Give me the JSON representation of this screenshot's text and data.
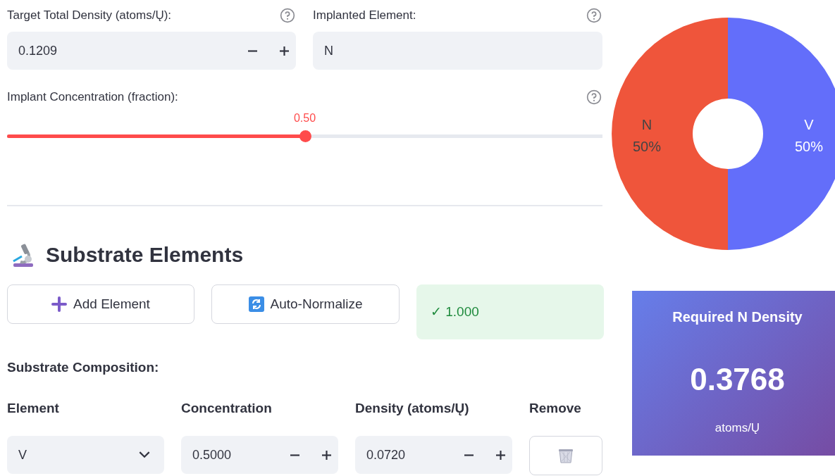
{
  "target_density": {
    "label": "Target Total Density (atoms/Ų):",
    "value": "0.1209"
  },
  "implanted_element": {
    "label": "Implanted Element:",
    "value": "N"
  },
  "implant_concentration": {
    "label": "Implant Concentration (fraction):",
    "reading": "0.50",
    "level": 0.5
  },
  "composition_chart": {
    "chart_data": {
      "type": "donut",
      "categories": [
        "N",
        "V"
      ],
      "values": [
        0.5,
        0.5
      ],
      "colors": [
        "#ef553b",
        "#636efa"
      ],
      "value_labels": [
        "50%",
        "50%"
      ]
    }
  },
  "substrate_section": {
    "title": "Substrate Elements",
    "buttons": [
      "Add Element",
      "Auto-Normalize"
    ],
    "sum_status": "✓ 1.000"
  },
  "required_density": {
    "title": "Required N Density",
    "value": "0.3768",
    "unit": "atoms/Ų"
  },
  "composition": {
    "title": "Substrate Composition:",
    "columns": [
      "Element",
      "Concentration",
      "Density (atoms/Ų)",
      "Remove"
    ],
    "rows": [
      {
        "element": "V",
        "concentration": "0.5000",
        "density": "0.0720"
      }
    ]
  }
}
